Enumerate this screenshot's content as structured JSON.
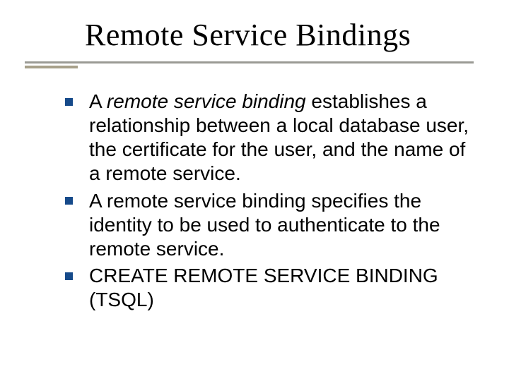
{
  "title": "Remote Service Bindings",
  "bullets": [
    {
      "italic_lead": "remote service binding",
      "prefix": "A ",
      "rest": " establishes a relationship between a local database user, the certificate for the user, and the name of a remote service."
    },
    {
      "text": "A remote service binding specifies the identity to be used to authenticate to the remote service."
    },
    {
      "text": "CREATE REMOTE SERVICE BINDING (TSQL)"
    }
  ]
}
